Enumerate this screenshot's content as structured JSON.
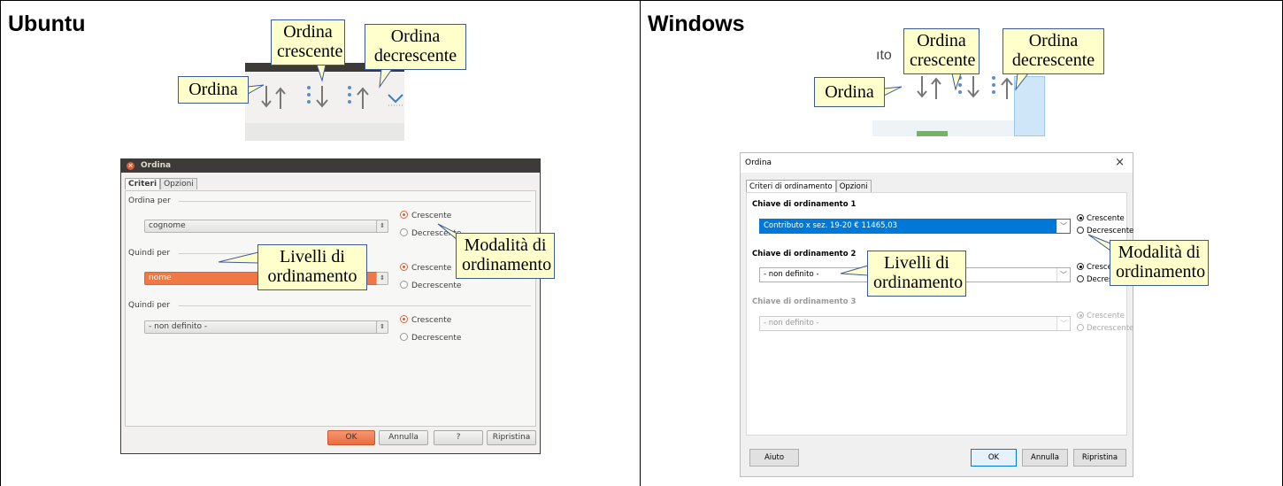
{
  "ubuntu": {
    "title": "Ubuntu",
    "callouts": {
      "sort": "Ordina",
      "ascending": "Ordina crescente",
      "descending": "Ordina decrescente",
      "levels": "Livelli di ordinamento",
      "mode": "Modalità di ordinamento"
    },
    "dialog": {
      "title": "Ordina",
      "close_glyph": "×",
      "tabs": [
        "Criteri",
        "Opzioni"
      ],
      "groups": [
        {
          "label": "Ordina per",
          "value": "cognome",
          "radio": [
            "Crescente",
            "Decrescente"
          ],
          "selected": 0
        },
        {
          "label": "Quindi per",
          "value": "nome",
          "radio": [
            "Crescente",
            "Decrescente"
          ],
          "selected": 0
        },
        {
          "label": "Quindi per",
          "value": "- non definito -",
          "radio": [
            "Crescente",
            "Decrescente"
          ],
          "selected": 0
        }
      ],
      "spin_glyph": "⇕",
      "buttons": {
        "ok": "OK",
        "cancel": "Annulla",
        "help": "?",
        "reset": "Ripristina"
      }
    }
  },
  "windows": {
    "title": "Windows",
    "toolbar_fragment": "ıto",
    "callouts": {
      "sort": "Ordina",
      "ascending": "Ordina crescente",
      "descending": "Ordina decrescente",
      "levels": "Livelli di ordinamento",
      "mode": "Modalità di ordinamento"
    },
    "dialog": {
      "title": "Ordina",
      "close_glyph": "×",
      "tabs": [
        "Criteri di ordinamento",
        "Opzioni"
      ],
      "keys": [
        {
          "label": "Chiave di ordinamento 1",
          "value": "Contributo x sez. 19-20 € 11465,03",
          "radio": [
            "Crescente",
            "Decrescente"
          ],
          "selected": 0,
          "enabled": true
        },
        {
          "label": "Chiave di ordinamento 2",
          "value": "- non definito -",
          "radio": [
            "Crescente",
            "Decrescente"
          ],
          "selected": 0,
          "enabled": true
        },
        {
          "label": "Chiave di ordinamento 3",
          "value": "- non definito -",
          "radio": [
            "Crescente",
            "Decrescente"
          ],
          "selected": 0,
          "enabled": false
        }
      ],
      "arrow_glyph": "﹀",
      "buttons": {
        "help": "Aiuto",
        "ok": "OK",
        "cancel": "Annulla",
        "reset": "Ripristina"
      }
    }
  },
  "colors": {
    "callout_bg": "#ffffcc",
    "callout_border": "#3b5998",
    "ubuntu_accent": "#f07846",
    "windows_accent": "#0078d7"
  }
}
